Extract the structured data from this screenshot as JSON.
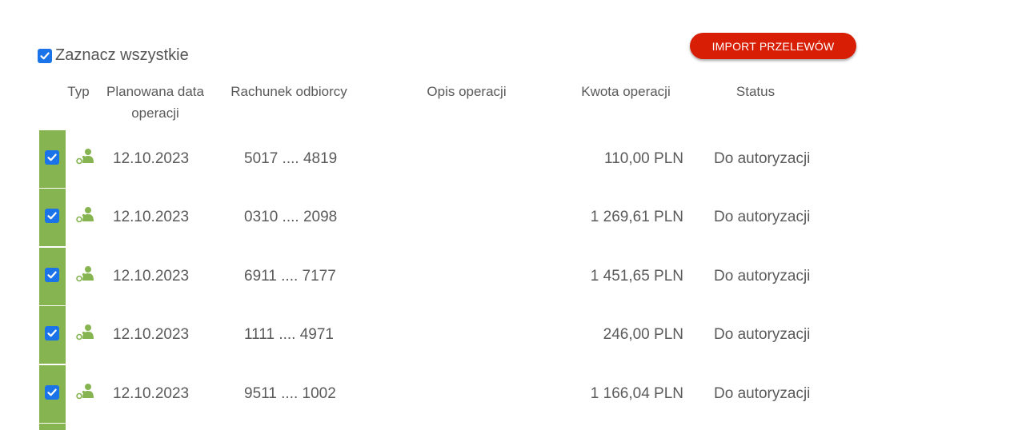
{
  "select_all": {
    "label": "Zaznacz wszystkie",
    "checked": true
  },
  "import_button": {
    "label": "IMPORT PRZELEWÓW"
  },
  "columns": {
    "type": "Typ",
    "date": "Planowana data operacji",
    "account": "Rachunek odbiorcy",
    "description": "Opis operacji",
    "amount": "Kwota operacji",
    "status": "Status"
  },
  "colors": {
    "accent_green": "#86b450",
    "button_red": "#d81e05",
    "checkbox_blue": "#1a73e8"
  },
  "rows": [
    {
      "checked": true,
      "type_icon": "person-transfer-icon",
      "date": "12.10.2023",
      "account": "5017 .... 4819",
      "description": "",
      "amount": "110,00 PLN",
      "status": "Do autoryzacji"
    },
    {
      "checked": true,
      "type_icon": "person-transfer-icon",
      "date": "12.10.2023",
      "account": "0310 .... 2098",
      "description": "",
      "amount": "1 269,61 PLN",
      "status": "Do autoryzacji"
    },
    {
      "checked": true,
      "type_icon": "person-transfer-icon",
      "date": "12.10.2023",
      "account": "6911 .... 7177",
      "description": "",
      "amount": "1 451,65 PLN",
      "status": "Do autoryzacji"
    },
    {
      "checked": true,
      "type_icon": "person-transfer-icon",
      "date": "12.10.2023",
      "account": "1111 .... 4971",
      "description": "",
      "amount": "246,00 PLN",
      "status": "Do autoryzacji"
    },
    {
      "checked": true,
      "type_icon": "person-transfer-icon",
      "date": "12.10.2023",
      "account": "9511 .... 1002",
      "description": "",
      "amount": "1 166,04 PLN",
      "status": "Do autoryzacji"
    }
  ]
}
